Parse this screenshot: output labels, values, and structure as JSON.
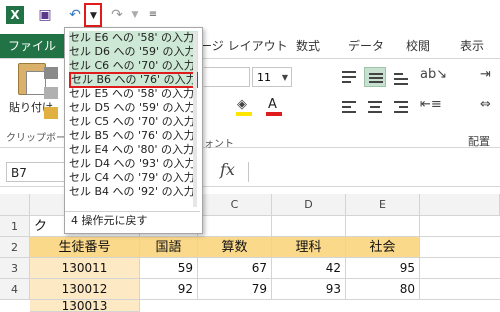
{
  "quick_access": {
    "excel_icon": "excel-icon",
    "save_icon": "save-icon",
    "undo_icon": "undo-icon",
    "redo_icon": "redo-icon",
    "customize_icon": "customize-icon"
  },
  "tabs": {
    "file": "ファイル",
    "page_layout_partial": "ージ レイアウト",
    "formulas": "数式",
    "data": "データ",
    "review": "校閲",
    "view": "表示"
  },
  "ribbon": {
    "paste_label": "貼り付け",
    "clipboard_label": "クリップボー",
    "font_group_label": "ォント",
    "font_size": "11",
    "alignment_label": "配置",
    "accent": "#217346"
  },
  "formula_bar": {
    "name_box": "B7",
    "fx_label": "fx"
  },
  "undo_dropdown": {
    "items": [
      "セル E6 への '58' の入力",
      "セル D6 への '59' の入力",
      "セル C6 への '70' の入力",
      "セル B6 への '76' の入力",
      "セル E5 への '58' の入力",
      "セル D5 への '59' の入力",
      "セル C5 への '70' の入力",
      "セル B5 への '76' の入力",
      "セル E4 への '80' の入力",
      "セル D4 への '93' の入力",
      "セル C4 への '79' の入力",
      "セル B4 への '92' の入力"
    ],
    "footer": "4 操作元に戻す"
  },
  "sheet": {
    "col_headers": [
      "C",
      "D",
      "E"
    ],
    "row_headers": [
      "1",
      "2",
      "3",
      "4"
    ],
    "row1_partial": "ク",
    "header_row": [
      "生徒番号",
      "国語",
      "算数",
      "理科",
      "社会"
    ],
    "rows": [
      [
        "130011",
        "59",
        "67",
        "42",
        "95"
      ],
      [
        "130012",
        "92",
        "79",
        "93",
        "80"
      ],
      [
        "130013",
        "",
        "",
        "",
        ""
      ]
    ]
  }
}
